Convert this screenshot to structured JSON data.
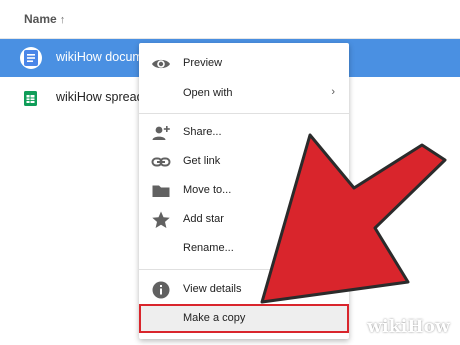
{
  "header": {
    "name_label": "Name",
    "sort_indicator": "↑"
  },
  "files": [
    {
      "name": "wikiHow documen",
      "type": "doc",
      "selected": true
    },
    {
      "name": "wikiHow spreadsl",
      "type": "sheet",
      "selected": false
    }
  ],
  "context_menu": {
    "items": [
      {
        "label": "Preview",
        "icon": "eye-icon"
      },
      {
        "label": "Open with",
        "icon": "",
        "submenu": "›"
      },
      {
        "label": "Share...",
        "icon": "person-add-icon"
      },
      {
        "label": "Get link",
        "icon": "link-icon"
      },
      {
        "label": "Move to...",
        "icon": "folder-icon"
      },
      {
        "label": "Add star",
        "icon": "star-icon"
      },
      {
        "label": "Rename...",
        "icon": ""
      },
      {
        "label": "View details",
        "icon": "info-icon"
      },
      {
        "label": "Make a copy",
        "icon": ""
      }
    ]
  },
  "watermark": "wikiHow",
  "colors": {
    "selection": "#4a90e2",
    "highlight_border": "#d9252c",
    "arrow_fill": "#d9252c",
    "doc_icon": "#4a86e8",
    "sheet_icon": "#0f9d58"
  }
}
